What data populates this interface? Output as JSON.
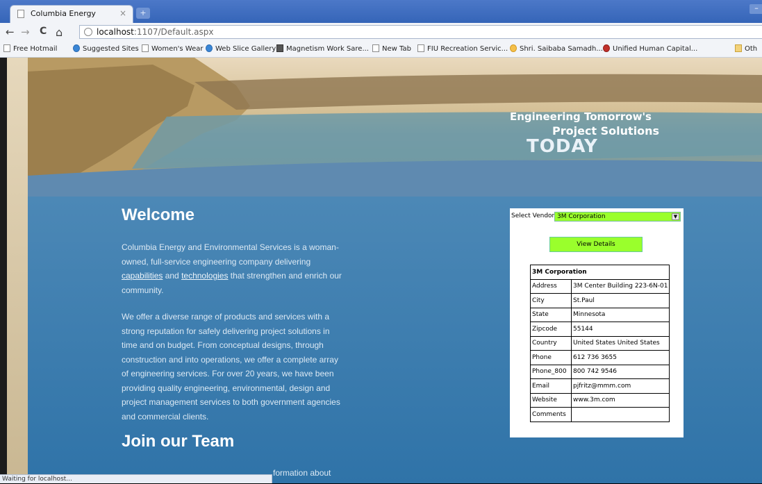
{
  "browser": {
    "tab_title": "Columbia Energy",
    "tab_close": "×",
    "new_tab": "+",
    "minimize": "–",
    "url_host": "localhost",
    "url_path": ":1107/Default.aspx",
    "nav_back": "←",
    "nav_forward": "→",
    "nav_reload": "C",
    "nav_home": "⌂",
    "bookmarks": [
      "Free Hotmail",
      "Suggested Sites",
      "Women's Wear",
      "Web Slice Gallery",
      "Magnetism Work Sare...",
      "New Tab",
      "FIU Recreation Servic...",
      "Shri. Saibaba Samadh...",
      "Unified Human Capital...",
      "Oth"
    ],
    "status": "Waiting for localhost..."
  },
  "banner": {
    "line1": "Engineering Tomorrow's",
    "line2": "Project Solutions",
    "line3": "TODAY"
  },
  "main": {
    "welcome_heading": "Welcome",
    "p1_a": "Columbia Energy and Environmental Services is a woman-owned, full-service engineering company delivering ",
    "p1_link1": "capabilities",
    "p1_and": " and ",
    "p1_link2": "technologies",
    "p1_b": " that strengthen and enrich our community.",
    "p2": "We offer a diverse range of products and services with a strong reputation for safely delivering project solutions in time and on budget. From conceptual designs, through construction and into operations, we offer a complete array of engineering services. For over 20 years, we have been providing quality engineering, environmental, design and project management services to both government agencies and commercial clients.",
    "join_heading": "Join our Team",
    "p3_partial": "formation about"
  },
  "vendor": {
    "select_label": "Select Vendor",
    "selected": "3M Corporation",
    "view_button": "View Details",
    "table_header": "3M Corporation",
    "rows": [
      {
        "key": "Address",
        "value": "3M Center Building 223-6N-01"
      },
      {
        "key": "City",
        "value": "St.Paul"
      },
      {
        "key": "State",
        "value": "Minnesota"
      },
      {
        "key": "Zipcode",
        "value": "55144"
      },
      {
        "key": "Country",
        "value": "United States United States"
      },
      {
        "key": "Phone",
        "value": "612 736 3655"
      },
      {
        "key": "Phone_800",
        "value": "800 742 9546"
      },
      {
        "key": "Email",
        "value": "pjfritz@mmm.com"
      },
      {
        "key": "Website",
        "value": "www.3m.com"
      },
      {
        "key": "Comments",
        "value": ""
      }
    ]
  },
  "colors": {
    "accent_green": "#9aff2c",
    "page_blue": "#2f73a8"
  }
}
